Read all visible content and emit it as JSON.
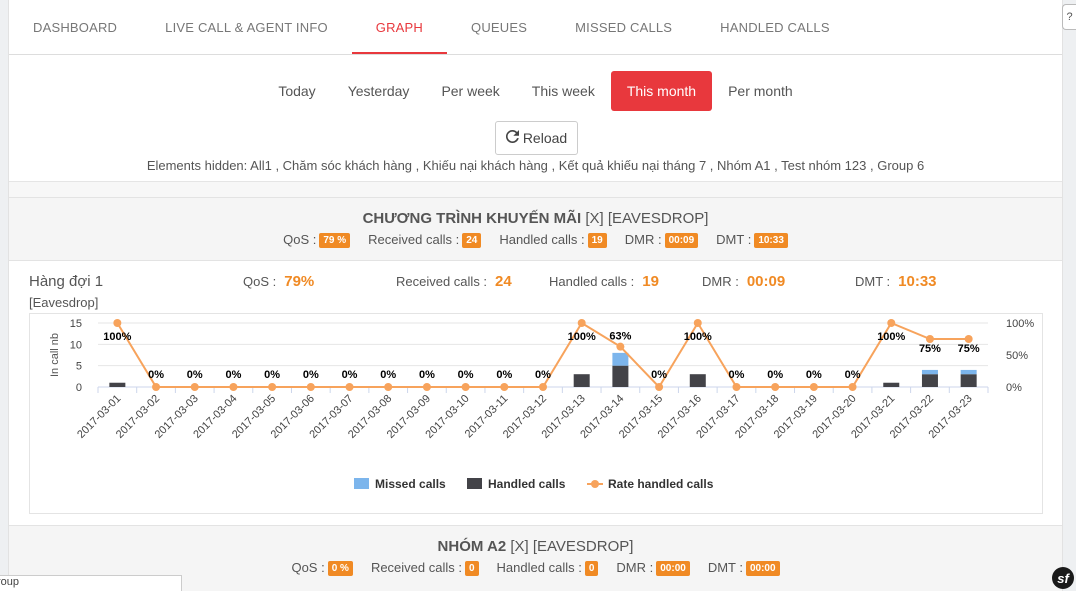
{
  "tabs": [
    {
      "label": "DASHBOARD",
      "active": false
    },
    {
      "label": "LIVE CALL & AGENT INFO",
      "active": false
    },
    {
      "label": "GRAPH",
      "active": true
    },
    {
      "label": "QUEUES",
      "active": false
    },
    {
      "label": "MISSED CALLS",
      "active": false
    },
    {
      "label": "HANDLED CALLS",
      "active": false
    }
  ],
  "periods": [
    {
      "label": "Today",
      "active": false
    },
    {
      "label": "Yesterday",
      "active": false
    },
    {
      "label": "Per week",
      "active": false
    },
    {
      "label": "This week",
      "active": false
    },
    {
      "label": "This month",
      "active": true
    },
    {
      "label": "Per month",
      "active": false
    }
  ],
  "reload": {
    "label": "Reload",
    "icon": "refresh-icon"
  },
  "hidden_elements": "Elements hidden: All1 , Chăm sóc khách hàng , Khiếu nại khách hàng , Kết quả khiếu nại tháng 7 , Nhóm A1 , Test nhóm 123 , Group 6",
  "groups": [
    {
      "title": "CHƯƠNG TRÌNH KHUYẾN MÃI",
      "suffix": "[X] [EAVESDROP]",
      "stats": {
        "qos_label": "QoS :",
        "qos": "79 %",
        "received_label": "Received calls :",
        "received": "24",
        "handled_label": "Handled calls :",
        "handled": "19",
        "dmr_label": "DMR :",
        "dmr": "00:09",
        "dmt_label": "DMT :",
        "dmt": "10:33"
      }
    },
    {
      "title": "NHÓM A2",
      "suffix": "[X] [EAVESDROP]",
      "stats": {
        "qos_label": "QoS :",
        "qos": "0 %",
        "received_label": "Received calls :",
        "received": "0",
        "handled_label": "Handled calls :",
        "handled": "0",
        "dmr_label": "DMR :",
        "dmr": "00:00",
        "dmt_label": "DMT :",
        "dmt": "00:00"
      }
    }
  ],
  "queue": {
    "name": "Hàng đợi 1",
    "eavesdrop": "[Eavesdrop]",
    "qos_label": "QoS :",
    "qos": "79%",
    "received_label": "Received calls :",
    "received": "24",
    "handled_label": "Handled calls :",
    "handled": "19",
    "dmr_label": "DMR :",
    "dmr": "00:09",
    "dmt_label": "DMT :",
    "dmt": "10:33"
  },
  "colors": {
    "accent": "#e8383d",
    "badge": "#f08a24",
    "missed": "#7cb5ec",
    "handled": "#434348",
    "rate": "#f7a35c"
  },
  "chart_data": {
    "type": "bar",
    "categories": [
      "2017-03-01",
      "2017-03-02",
      "2017-03-03",
      "2017-03-04",
      "2017-03-05",
      "2017-03-06",
      "2017-03-07",
      "2017-03-08",
      "2017-03-09",
      "2017-03-10",
      "2017-03-11",
      "2017-03-12",
      "2017-03-13",
      "2017-03-14",
      "2017-03-15",
      "2017-03-16",
      "2017-03-17",
      "2017-03-18",
      "2017-03-19",
      "2017-03-20",
      "2017-03-21",
      "2017-03-22",
      "2017-03-23"
    ],
    "series": [
      {
        "name": "Missed calls",
        "type": "bar",
        "stacked": true,
        "values": [
          0,
          0,
          0,
          0,
          0,
          0,
          0,
          0,
          0,
          0,
          0,
          0,
          0,
          3,
          0,
          0,
          0,
          0,
          0,
          0,
          0,
          1,
          1
        ]
      },
      {
        "name": "Handled calls",
        "type": "bar",
        "stacked": true,
        "values": [
          1,
          0,
          0,
          0,
          0,
          0,
          0,
          0,
          0,
          0,
          0,
          0,
          3,
          5,
          0,
          3,
          0,
          0,
          0,
          0,
          1,
          3,
          3
        ]
      },
      {
        "name": "Rate handled calls",
        "type": "line",
        "axis": "right",
        "values": [
          100,
          0,
          0,
          0,
          0,
          0,
          0,
          0,
          0,
          0,
          0,
          0,
          100,
          63,
          0,
          100,
          0,
          0,
          0,
          0,
          100,
          75,
          75
        ]
      }
    ],
    "ylabel": "In call nb",
    "ylim": [
      0,
      15
    ],
    "yticks": [
      "0",
      "5",
      "10",
      "15"
    ],
    "y2ticks": [
      "0%",
      "50%",
      "100%"
    ],
    "y2lim": [
      0,
      100
    ],
    "legend_position": "bottom"
  },
  "footer": {
    "bar_text": "roup",
    "help": "?",
    "sf": "sf"
  }
}
